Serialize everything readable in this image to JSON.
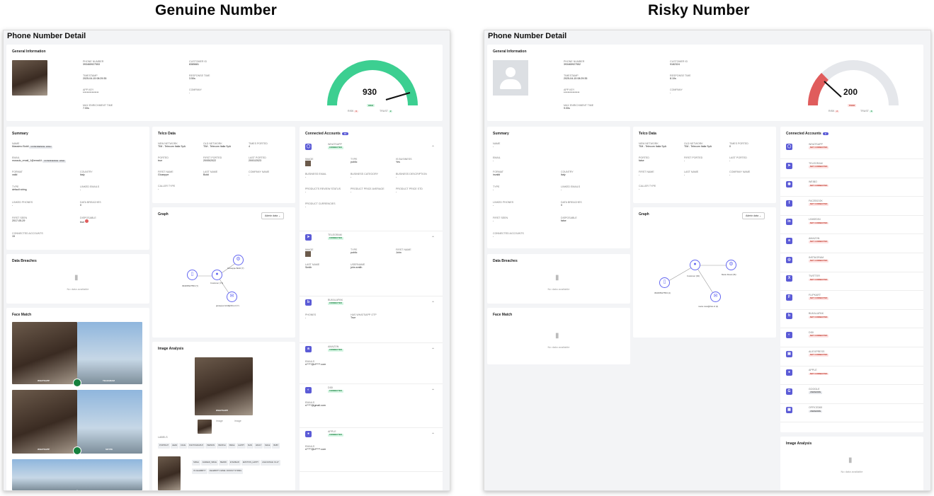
{
  "headers": {
    "left": "Genuine Number",
    "right": "Risky Number"
  },
  "common": {
    "page_title": "Phone Number Detail",
    "general_info": "General Information",
    "summary": "Summary",
    "telco": "Telco Data",
    "connected": "Connected Accounts",
    "graph": "Graph",
    "admin_btn": "Admin data ⌄",
    "breaches": "Data Breaches",
    "face": "Face Match",
    "image_analysis": "Image Analysis",
    "no_data": "No data available",
    "l_phone": "PHONE NUMBER",
    "l_customer": "CUSTOMER ID",
    "l_timestamp": "TIMESTAMP",
    "l_response": "RESPONSE TIME",
    "l_appkey": "APP KEY",
    "l_company": "COMPANY",
    "l_max": "MAX ENRICHMENT TIME",
    "l_name": "NAME",
    "l_email": "EMAIL",
    "l_format": "FORMAT",
    "l_country": "COUNTRY",
    "l_type": "TYPE",
    "l_linked_emails": "LINKED EMAILS",
    "l_linked_phones": "LINKED PHONES",
    "l_data_breaches": "DATA BREACHES",
    "l_first_seen": "FIRST SEEN",
    "l_disposable": "DISPOSABLE",
    "l_conn_accounts": "CONNECTED ACCOUNTS",
    "l_new_net": "NEW NETWORK",
    "l_old_net": "OLD NETWORK",
    "l_times_ported": "TIMES PORTED",
    "l_ported": "PORTED",
    "l_first_ported": "FIRST PORTED",
    "l_last_ported": "LAST PORTED",
    "l_first_name": "FIRST NAME",
    "l_last_name": "LAST NAME",
    "l_company_name": "COMPANY NAME",
    "l_caller_type": "CALLER TYPE",
    "risk": "RISK",
    "trust": "TRUST"
  },
  "genuine": {
    "phone": "393465927553",
    "customer": "8385681",
    "timestamp": "2025-04-15 08:29:35",
    "response": "3.50s",
    "appkey": "****************",
    "company": "-",
    "max": "7.00s",
    "score": "930",
    "score_badge": "HIGH",
    "risk": "0",
    "trust": "2",
    "name": "Massimo Boldi",
    "name_badge": "CONFIDENCE: HIGH",
    "email": "mussdo_email_1@email.it",
    "email_badge": "CONFIDENCE: HIGH",
    "format": "valid",
    "country": "Italy",
    "type": "default string",
    "linked_emails": "-",
    "linked_phones": "-",
    "data_breaches": "0",
    "first_seen": "2017-05-29",
    "disposable": "true",
    "conn": "15",
    "new_net": "TIM - Telecom Italia SpA",
    "old_net": "TIM - Telecom Italia SpA",
    "times_ported": "4",
    "ported": "true",
    "first_ported": "20/05/2022",
    "last_ported": "20/01/2023",
    "first_name": "Giuseppe",
    "last_name": "Boldi",
    "company_name": "-",
    "caller_type": "-",
    "conn_count": "15",
    "graph_nodes": [
      "Giuseppe Boldi (Y)",
      "Customer (Y1)",
      "393465927553 (Y)",
      "giuseppe.boldi@fido.sf (Y)"
    ],
    "face_labels": [
      "WHATSAPP",
      "TELEGRAM",
      "WHATSAPP",
      "SKYPE"
    ],
    "ia_caption": "WHATSAPP",
    "ia_labels_title": "LABELS",
    "ia_labels": [
      "PORTRAIT",
      "HEAD",
      "FACE",
      "PHOTOGRAPHY",
      "PERSON",
      "PEOPLE",
      "SMILE",
      "HAPPY",
      "MAN",
      "ADULT",
      "MALE",
      "BABY"
    ],
    "ia_labels2": [
      "SMILE",
      "AGREED_SMILE",
      "BEARD",
      "EYEWEAR",
      "EMOTION_HAPPY",
      "AGE RANGE: 19-27",
      "IS CELEBRITY",
      "CELEBRITY NAME: NONOUT STRING"
    ],
    "img_alt": "image",
    "accounts": [
      {
        "name": "WHATSAPP",
        "status": "CONNECTED",
        "icon": "whatsapp-icon",
        "fields": [
          [
            "IMAGE",
            ""
          ],
          [
            "TYPE",
            "public"
          ],
          [
            "IS BUSINESS",
            "Yes"
          ],
          [
            "BUSINESS EMAIL",
            "-"
          ],
          [
            "BUSINESS CATEGORY",
            "-"
          ],
          [
            "BUSINESS DESCRIPTION",
            "-"
          ],
          [
            "PRODUCTS REVIEW STATUS",
            "-"
          ],
          [
            "PRODUCT PRICE AVERAGE",
            "-"
          ],
          [
            "PRODUCT PRICE STD",
            "-"
          ],
          [
            "PRODUCT CURRENCIES",
            "-"
          ]
        ]
      },
      {
        "name": "TELEGRAM",
        "status": "CONNECTED",
        "icon": "telegram-icon",
        "fields": [
          [
            "IMAGE",
            ""
          ],
          [
            "TYPE",
            "public"
          ],
          [
            "FIRST NAME",
            "John"
          ],
          [
            "LAST NAME",
            "Smith"
          ],
          [
            "USERNAME",
            "john.smith"
          ]
        ]
      },
      {
        "name": "BUKALAPAK",
        "status": "CONNECTED",
        "icon": "bukalapak-icon",
        "fields": [
          [
            "PHONES",
            "-"
          ],
          [
            "HAS WHATSAPP OTP",
            "True"
          ]
        ]
      },
      {
        "name": "AMAZON",
        "status": "CONNECTED",
        "icon": "amazon-icon",
        "fields": [
          [
            "EMAILS",
            "s*****@d*****.com"
          ]
        ]
      },
      {
        "name": "DIDI",
        "status": "CONNECTED",
        "icon": "didi-icon",
        "fields": [
          [
            "EMAILS",
            "s*****@gmail.com"
          ]
        ]
      },
      {
        "name": "APPLE",
        "status": "CONNECTED",
        "icon": "apple-icon",
        "fields": [
          [
            "EMAILS",
            "s*****@d*****.com"
          ]
        ]
      }
    ]
  },
  "risky": {
    "phone": "393465927552",
    "customer": "9182324",
    "timestamp": "2025-04-15 08:29:35",
    "response": "8.10s",
    "appkey": "****************",
    "company": "-",
    "max": "9.00s",
    "score": "200",
    "score_badge": "POOR",
    "risk": "2",
    "trust": "0",
    "name": "-",
    "email": "-",
    "format": "invalid",
    "country": "Italy",
    "type": "-",
    "linked_emails": "-",
    "linked_phones": "-",
    "data_breaches": "0",
    "first_seen": "-",
    "disposable": "false",
    "conn": "-",
    "new_net": "TIM - Telecom Italia SpA",
    "old_net": "TIM - Telecom Italia SpA",
    "times_ported": "0",
    "ported": "false",
    "first_ported": "-",
    "last_ported": "-",
    "first_name": "-",
    "last_name": "-",
    "company_name": "-",
    "caller_type": "-",
    "conn_count": "0",
    "graph_nodes": [
      "Customer (94)",
      "Mario Rossi (36)",
      "393465927553 (4)",
      "mario.rossi@fido.sf (4)"
    ],
    "accounts": [
      {
        "name": "WHATSAPP",
        "status": "NOT CONNECTED",
        "icon": "whatsapp-icon"
      },
      {
        "name": "TELEGRAM",
        "status": "NOT CONNECTED",
        "icon": "telegram-icon"
      },
      {
        "name": "WEIBO",
        "status": "NOT CONNECTED",
        "icon": "weibo-icon"
      },
      {
        "name": "FACEBOOK",
        "status": "NOT CONNECTED",
        "icon": "facebook-icon"
      },
      {
        "name": "LINKEDIN",
        "status": "NOT CONNECTED",
        "icon": "linkedin-icon"
      },
      {
        "name": "AMAZON",
        "status": "NOT CONNECTED",
        "icon": "amazon-icon"
      },
      {
        "name": "INSTAGRAM",
        "status": "NOT CONNECTED",
        "icon": "instagram-icon"
      },
      {
        "name": "TWITTER",
        "status": "NOT CONNECTED",
        "icon": "twitter-icon"
      },
      {
        "name": "FLIPKART",
        "status": "NOT CONNECTED",
        "icon": "flipkart-icon"
      },
      {
        "name": "BUKALAPAK",
        "status": "NOT CONNECTED",
        "icon": "bukalapak-icon"
      },
      {
        "name": "DIDI",
        "status": "NOT CONNECTED",
        "icon": "didi-icon"
      },
      {
        "name": "ALIEXPRESS",
        "status": "NOT CONNECTED",
        "icon": "aliexpress-icon"
      },
      {
        "name": "APPLE",
        "status": "NOT CONNECTED",
        "icon": "apple-icon"
      },
      {
        "name": "GOOGLE",
        "status": "UNKNOWN",
        "icon": "google-icon"
      },
      {
        "name": "OFFICE365",
        "status": "UNKNOWN",
        "icon": "office365-icon"
      }
    ]
  },
  "colors": {
    "accent": "#5b5bd6",
    "gauge_good": "#3ccf91",
    "gauge_bad": "#e05c5c",
    "gauge_track": "#e5e7eb"
  }
}
